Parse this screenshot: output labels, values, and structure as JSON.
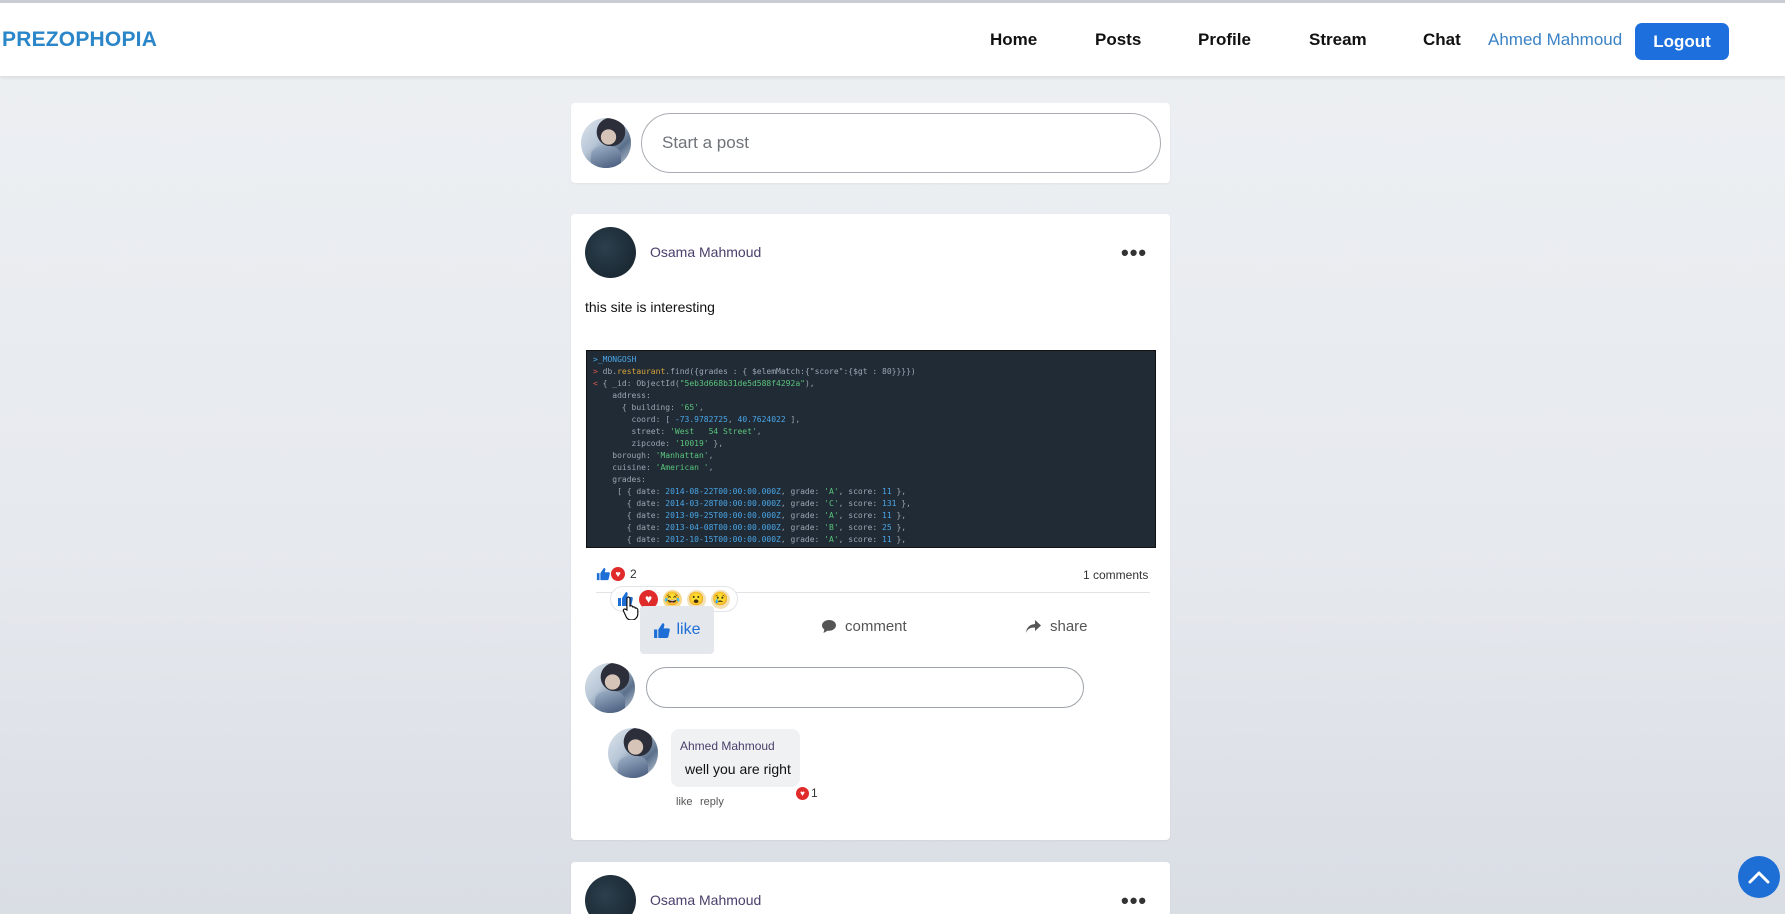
{
  "brand": "PREZOPHOPIA",
  "nav": {
    "home": "Home",
    "posts": "Posts",
    "profile": "Profile",
    "stream": "Stream",
    "chat": "Chat",
    "user": "Ahmed Mahmoud",
    "logout": "Logout"
  },
  "composer": {
    "placeholder": "Start a post"
  },
  "posts": [
    {
      "author": "Osama Mahmoud",
      "text": "this site is interesting",
      "reaction_count": "2",
      "comments_count": "1 comments",
      "actions": {
        "like": "like",
        "comment": "comment",
        "share": "share"
      },
      "reaction_picker": [
        "like",
        "love",
        "haha",
        "wow",
        "sad"
      ],
      "comments": [
        {
          "author": "Ahmed Mahmoud",
          "text": "well you are right",
          "reaction_count": "1",
          "like_label": "like",
          "reply_label": "reply"
        }
      ]
    },
    {
      "author": "Osama Mahmoud"
    }
  ],
  "colors": {
    "brand": "#2a86c8",
    "primary": "#1c6fdc",
    "heart": "#e02b2b",
    "author": "#4a3f6b"
  },
  "icons": [
    "thumbs-up-icon",
    "heart-icon",
    "comment-icon",
    "share-icon",
    "more-icon",
    "chevron-up-icon"
  ]
}
